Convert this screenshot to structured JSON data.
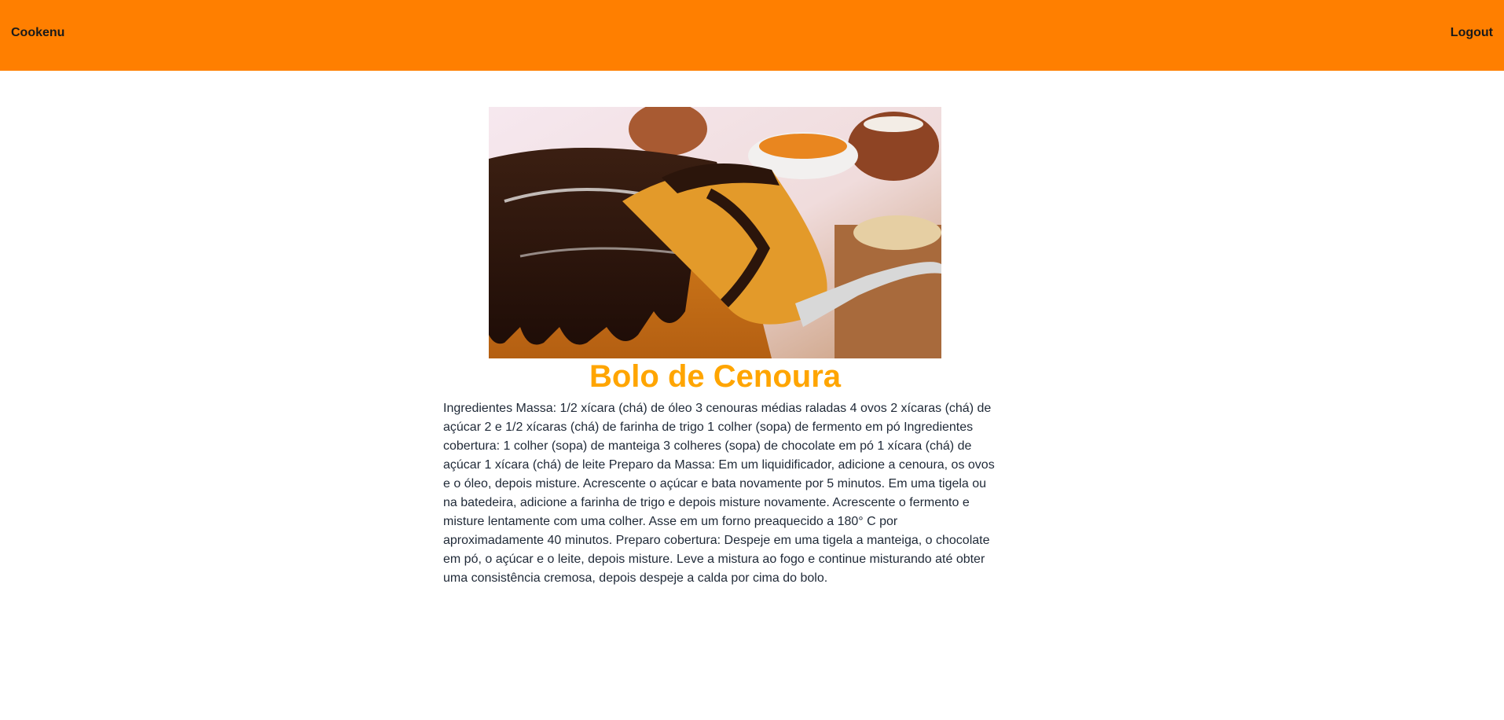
{
  "header": {
    "brand_label": "Cookenu",
    "logout_label": "Logout",
    "background_color": "#ff7f00"
  },
  "recipe": {
    "title": "Bolo de Cenoura",
    "title_color": "#ffa500",
    "description": "Ingredientes Massa: 1/2 xícara (chá) de óleo 3 cenouras médias raladas 4 ovos 2 xícaras (chá) de açúcar 2 e 1/2 xícaras (chá) de farinha de trigo 1 colher (sopa) de fermento em pó Ingredientes cobertura: 1 colher (sopa) de manteiga 3 colheres (sopa) de chocolate em pó 1 xícara (chá) de açúcar 1 xícara (chá) de leite Preparo da Massa: Em um liquidificador, adicione a cenoura, os ovos e o óleo, depois misture. Acrescente o açúcar e bata novamente por 5 minutos. Em uma tigela ou na batedeira, adicione a farinha de trigo e depois misture novamente. Acrescente o fermento e misture lentamente com uma colher. Asse em um forno preaquecido a 180° C por aproximadamente 40 minutos. Preparo cobertura: Despeje em uma tigela a manteiga, o chocolate em pó, o açúcar e o leite, depois misture. Leve a mistura ao fogo e continue misturando até obter uma consistência cremosa, depois despeje a calda por cima do bolo."
  }
}
